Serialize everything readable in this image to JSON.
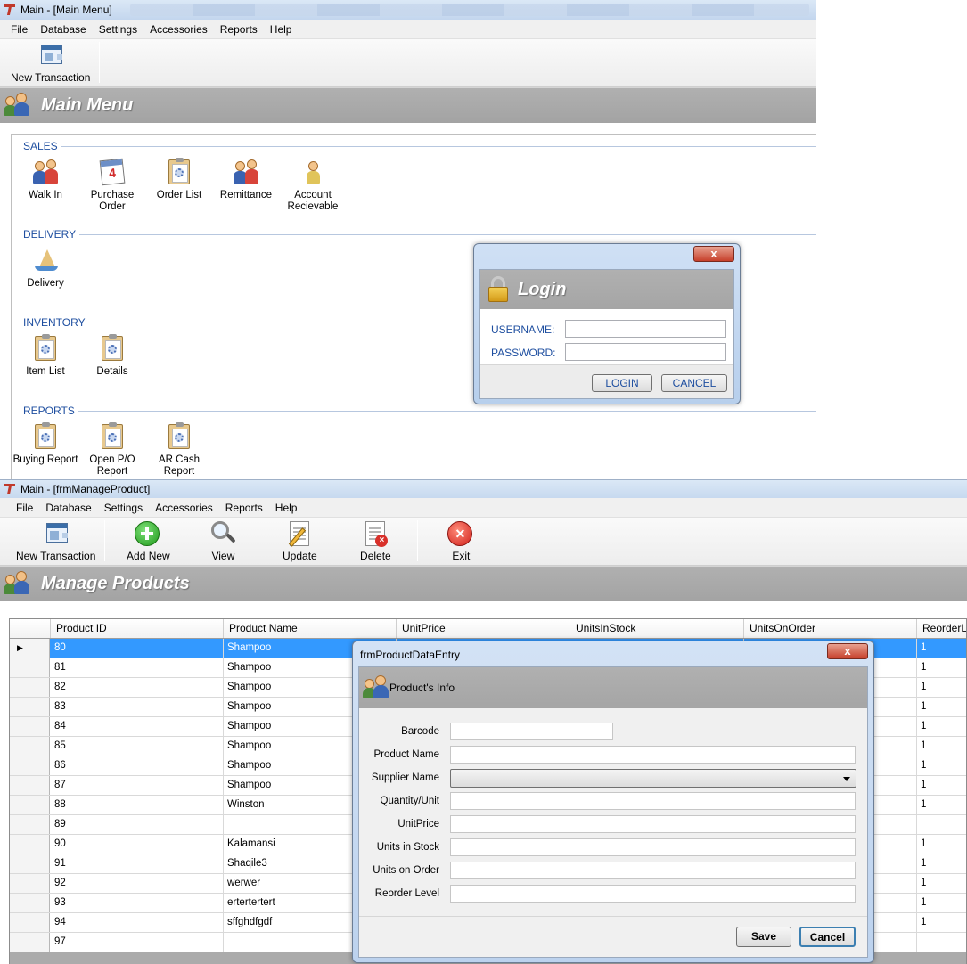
{
  "main_window": {
    "title": "Main - [Main Menu]",
    "menu": [
      "File",
      "Database",
      "Settings",
      "Accessories",
      "Reports",
      "Help"
    ],
    "toolbar": {
      "new_transaction": "New Transaction"
    },
    "header_title": "Main Menu",
    "groups": {
      "sales": {
        "label": "SALES",
        "items": [
          {
            "line1": "Walk In",
            "line2": ""
          },
          {
            "line1": "Purchase",
            "line2": "Order"
          },
          {
            "line1": "Order List",
            "line2": ""
          },
          {
            "line1": "Remittance",
            "line2": ""
          },
          {
            "line1": "Account",
            "line2": "Recievable"
          }
        ]
      },
      "delivery": {
        "label": "DELIVERY",
        "items": [
          {
            "line1": "Delivery",
            "line2": ""
          }
        ]
      },
      "inventory": {
        "label": "INVENTORY",
        "items": [
          {
            "line1": "Item List",
            "line2": ""
          },
          {
            "line1": "Details",
            "line2": ""
          }
        ]
      },
      "reports": {
        "label": "REPORTS",
        "items": [
          {
            "line1": "Buying Report",
            "line2": ""
          },
          {
            "line1": "Open P/O",
            "line2": "Report"
          },
          {
            "line1": "AR Cash",
            "line2": "Report"
          }
        ]
      }
    }
  },
  "login_dialog": {
    "close": "x",
    "title": "Login",
    "username_label": "USERNAME:",
    "password_label": "PASSWORD:",
    "username_value": "",
    "password_value": "",
    "login_button": "LOGIN",
    "cancel_button": "CANCEL"
  },
  "product_window": {
    "title": "Main - [frmManageProduct]",
    "menu": [
      "File",
      "Database",
      "Settings",
      "Accessories",
      "Reports",
      "Help"
    ],
    "toolbar": {
      "new_transaction": "New Transaction",
      "add_new": "Add New",
      "view": "View",
      "update": "Update",
      "delete": "Delete",
      "exit": "Exit"
    },
    "header_title": "Manage Products",
    "grid": {
      "columns": [
        "Product ID",
        "Product Name",
        "UnitPrice",
        "UnitsInStock",
        "UnitsOnOrder",
        "ReorderLe"
      ],
      "row_marker": "▶",
      "rows": [
        {
          "id": "80",
          "name": "Shampoo",
          "reorder": "1"
        },
        {
          "id": "81",
          "name": "Shampoo",
          "reorder": "1"
        },
        {
          "id": "82",
          "name": "Shampoo",
          "reorder": "1"
        },
        {
          "id": "83",
          "name": "Shampoo",
          "reorder": "1"
        },
        {
          "id": "84",
          "name": "Shampoo",
          "reorder": "1"
        },
        {
          "id": "85",
          "name": "Shampoo",
          "reorder": "1"
        },
        {
          "id": "86",
          "name": "Shampoo",
          "reorder": "1"
        },
        {
          "id": "87",
          "name": "Shampoo",
          "reorder": "1"
        },
        {
          "id": "88",
          "name": "Winston",
          "reorder": "1"
        },
        {
          "id": "89",
          "name": "",
          "reorder": ""
        },
        {
          "id": "90",
          "name": "Kalamansi",
          "reorder": "1"
        },
        {
          "id": "91",
          "name": "Shaqile3",
          "reorder": "1"
        },
        {
          "id": "92",
          "name": "werwer",
          "reorder": "1"
        },
        {
          "id": "93",
          "name": "ertertertert",
          "reorder": "1"
        },
        {
          "id": "94",
          "name": "sffghdfgdf",
          "reorder": "1"
        },
        {
          "id": "97",
          "name": "",
          "reorder": ""
        }
      ]
    }
  },
  "product_dialog": {
    "window_title": "frmProductDataEntry",
    "close": "x",
    "header_title": "Product's Info",
    "fields": {
      "barcode": "Barcode",
      "product_name": "Product Name",
      "supplier_name": "Supplier Name",
      "quantity_unit": "Quantity/Unit",
      "unit_price": "UnitPrice",
      "units_in_stock": "Units in Stock",
      "units_on_order": "Units on Order",
      "reorder_level": "Reorder Level"
    },
    "save_button": "Save",
    "cancel_button": "Cancel"
  },
  "colors": {
    "accent_blue": "#1f4fa0",
    "header_band": "#a8a8a8",
    "selection": "#3399ff",
    "close_red": "#c7402b"
  },
  "icons": [
    "app-icon",
    "new-transaction-icon",
    "people-icon",
    "lock-icon",
    "add-icon",
    "search-icon",
    "edit-icon",
    "delete-icon",
    "exit-icon",
    "clipboard-icon",
    "calendar-icon",
    "ship-icon"
  ]
}
